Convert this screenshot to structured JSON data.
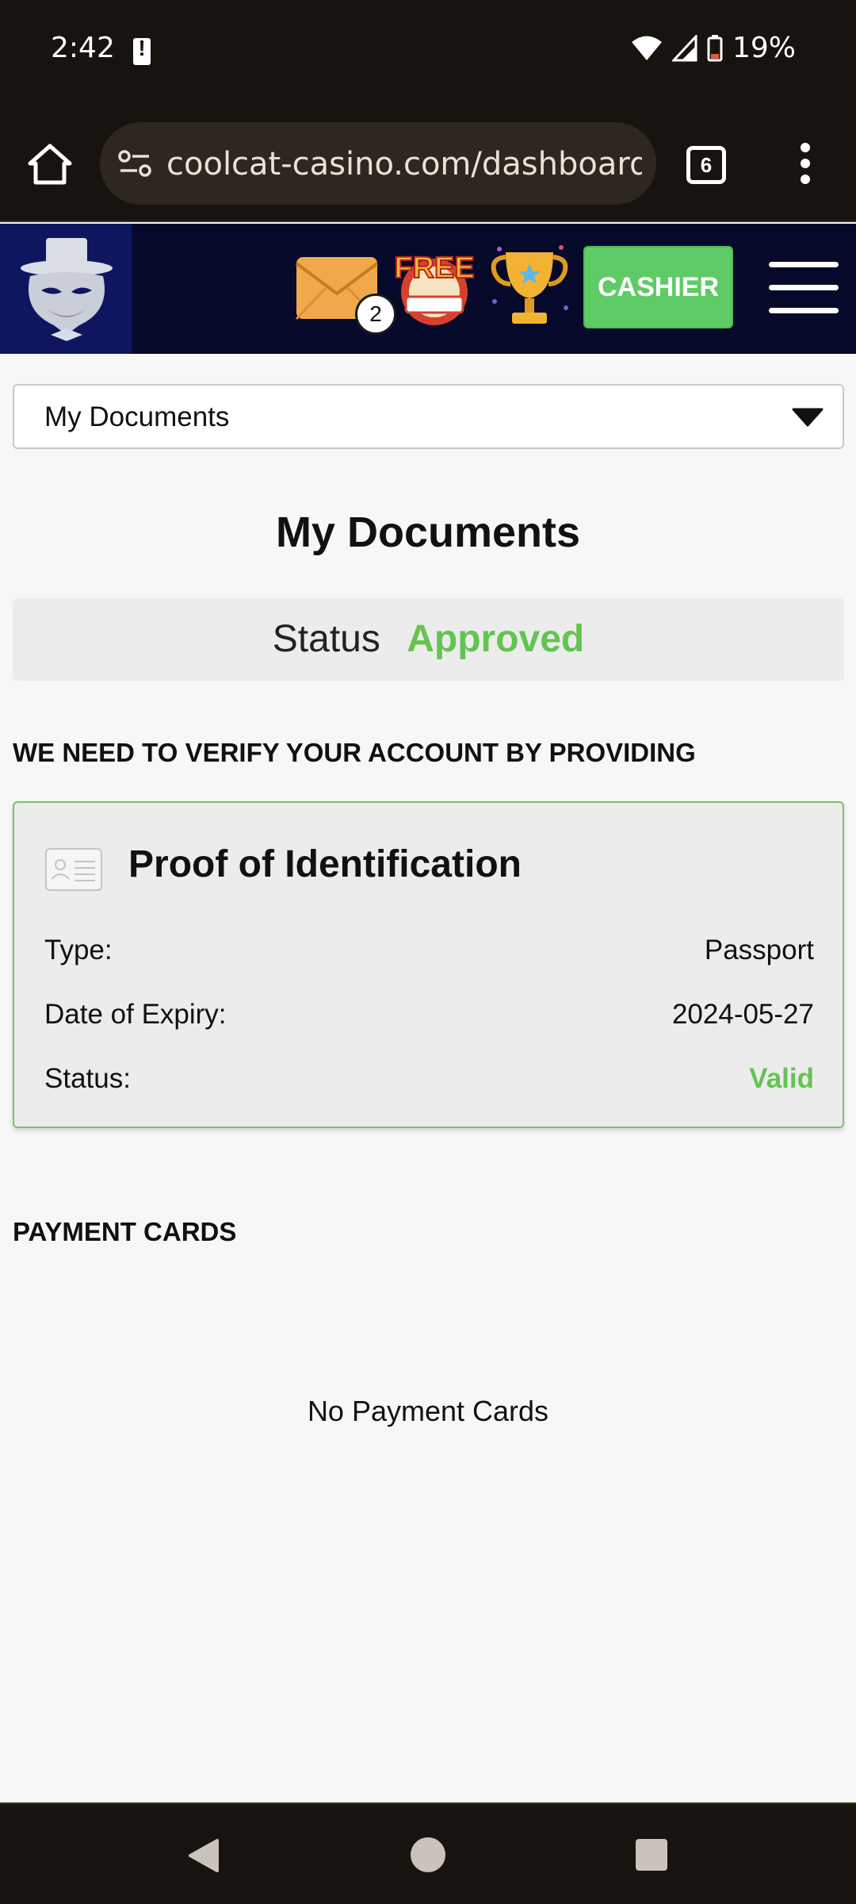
{
  "status_bar": {
    "time": "2:42",
    "battery": "19%"
  },
  "browser": {
    "url": "coolcat-casino.com/dashboard/",
    "tab_count": "6"
  },
  "header": {
    "mail_badge": "2",
    "free_spins_text": "FREE",
    "cashier_label": "CASHIER"
  },
  "select": {
    "label": "My Documents"
  },
  "page": {
    "title": "My Documents",
    "status_label": "Status",
    "status_value": "Approved",
    "verify_heading": "WE NEED TO VERIFY YOUR ACCOUNT BY PROVIDING"
  },
  "id_card": {
    "title": "Proof of Identification",
    "rows": [
      {
        "key": "Type:",
        "value": "Passport"
      },
      {
        "key": "Date of Expiry:",
        "value": "2024-05-27"
      },
      {
        "key": "Status:",
        "value": "Valid"
      }
    ]
  },
  "payment_cards": {
    "heading": "PAYMENT CARDS",
    "empty_text": "No Payment Cards"
  },
  "colors": {
    "accent_green": "#63c451",
    "header_bg": "#06092a",
    "cashier_bg": "#5fcb66"
  },
  "icons": [
    "home-icon",
    "site-settings-icon",
    "more-vert-icon",
    "logo-icon",
    "mail-icon",
    "free-spins-icon",
    "trophy-icon",
    "menu-icon",
    "id-card-icon",
    "caret-down-icon",
    "nav-back-icon",
    "nav-home-icon",
    "nav-recents-icon"
  ]
}
